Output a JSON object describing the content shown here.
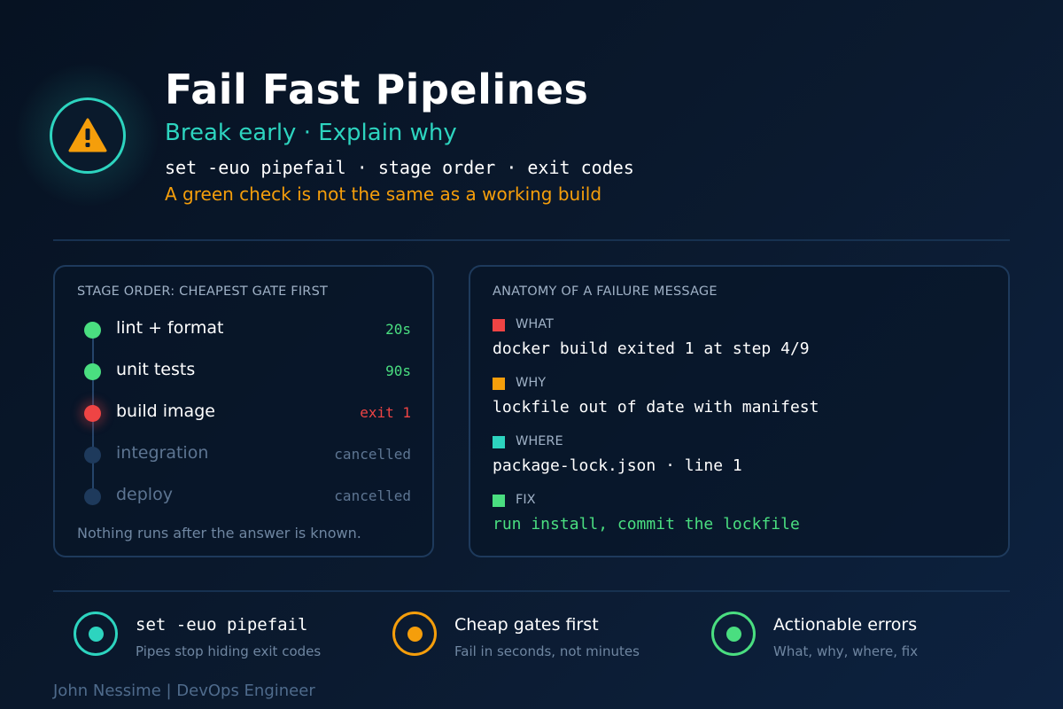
{
  "header": {
    "icon": "warning-triangle-icon",
    "title": "Fail Fast Pipelines",
    "subtitle": "Break early · Explain why",
    "command_line": "set -euo pipefail · stage order · exit codes",
    "warning": "A green check is not the same as a working build"
  },
  "stages_panel": {
    "heading": "STAGE ORDER: CHEAPEST GATE FIRST",
    "stages": [
      {
        "name": "lint + format",
        "result": "20s",
        "status": "passed"
      },
      {
        "name": "unit tests",
        "result": "90s",
        "status": "passed"
      },
      {
        "name": "build image",
        "result": "exit 1",
        "status": "failed"
      },
      {
        "name": "integration",
        "result": "cancelled",
        "status": "cancelled"
      },
      {
        "name": "deploy",
        "result": "cancelled",
        "status": "cancelled"
      }
    ],
    "footnote": "Nothing runs after the answer is known."
  },
  "anatomy_panel": {
    "heading": "ANATOMY OF A FAILURE MESSAGE",
    "items": [
      {
        "label": "WHAT",
        "value": "docker build exited 1 at step 4/9",
        "color": "#ef4444"
      },
      {
        "label": "WHY",
        "value": "lockfile out of date with manifest",
        "color": "#f59e0b"
      },
      {
        "label": "WHERE",
        "value": "package-lock.json · line 1",
        "color": "#2dd4bf"
      },
      {
        "label": "FIX",
        "value": "run install, commit the lockfile",
        "color": "#4ade80"
      }
    ]
  },
  "tips": [
    {
      "title": "set -euo pipefail",
      "subtitle": "Pipes stop hiding exit codes",
      "color": "#2dd4bf"
    },
    {
      "title": "Cheap gates first",
      "subtitle": "Fail in seconds, not minutes",
      "color": "#f59e0b"
    },
    {
      "title": "Actionable errors",
      "subtitle": "What, why, where, fix",
      "color": "#4ade80"
    }
  ],
  "author": "John Nessime | DevOps Engineer",
  "colors": {
    "accent_teal": "#2dd4bf",
    "accent_amber": "#f59e0b",
    "success_green": "#4ade80",
    "error_red": "#ef4444"
  }
}
